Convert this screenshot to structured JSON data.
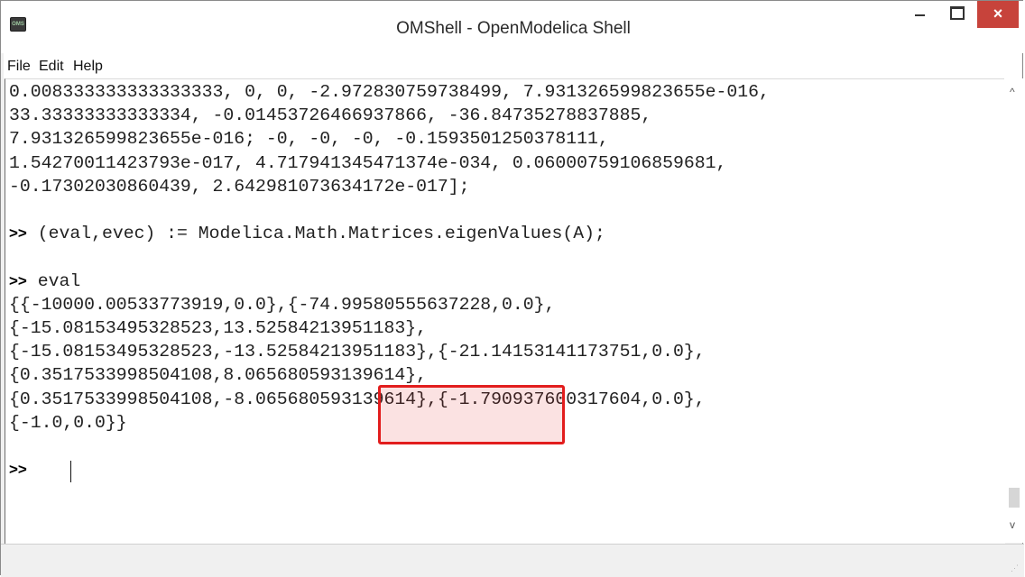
{
  "window": {
    "title": "OMShell - OpenModelica Shell",
    "icon_label": "OMS",
    "close_glyph": "×"
  },
  "menu": [
    "File",
    "Edit",
    "Help"
  ],
  "console": {
    "lines": [
      {
        "text": "0.008333333333333333, 0, 0, -2.972830759738499, 7.931326599823655e-016,"
      },
      {
        "text": "33.33333333333334, -0.01453726466937866, -36.84735278837885,"
      },
      {
        "text": "7.931326599823655e-016; -0, -0, -0, -0.1593501250378111,"
      },
      {
        "text": "1.54270011423793e-017, 4.717941345471374e-034, 0.06000759106859681,"
      },
      {
        "text": "-0.17302030860439, 2.642981073634172e-017];"
      },
      {
        "text": ""
      },
      {
        "prompt": ">>",
        "text": " (eval,evec) := Modelica.Math.Matrices.eigenValues(A);"
      },
      {
        "text": ""
      },
      {
        "prompt": ">>",
        "text": " eval"
      },
      {
        "text": "{{-10000.00533773919,0.0},{-74.99580555637228,0.0},"
      },
      {
        "text": "{-15.08153495328523,13.52584213951183},"
      },
      {
        "text": "{-15.08153495328523,-13.52584213951183},{-21.14153141173751,0.0},"
      },
      {
        "text": "{0.3517533998504108,8.065680593139614},"
      },
      {
        "text": "{0.3517533998504108,-8.065680593139614},{-1.790937600317604,0.0},"
      },
      {
        "text": "{-1.0,0.0}}"
      },
      {
        "text": ""
      },
      {
        "prompt": ">>",
        "text": " "
      }
    ]
  },
  "highlight_color": "#e21d1d",
  "scrollbar": {
    "up_glyph": "^",
    "down_glyph": "v"
  }
}
